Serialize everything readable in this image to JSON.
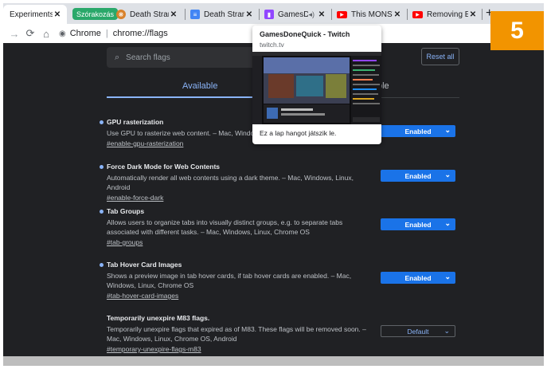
{
  "tabs": [
    {
      "title": "Experiments",
      "close": "✕",
      "favicon": "none",
      "active": true
    },
    {
      "title": "Death Stranding",
      "close": "✕",
      "favicon": "fan-icon"
    },
    {
      "title": "Death Stranding",
      "close": "✕",
      "favicon": "document-icon"
    },
    {
      "title": "GamesDone",
      "close": "✕",
      "favicon": "twitch-icon",
      "audio": "speaker-icon"
    },
    {
      "title": "This MONSTER",
      "close": "✕",
      "favicon": "youtube-icon"
    },
    {
      "title": "Removing EVER",
      "close": "✕",
      "favicon": "youtube-icon"
    }
  ],
  "tab_group": {
    "label": "Szórakozás",
    "color": "#2aa86a"
  },
  "new_tab": "+",
  "toolbar": {
    "site_label": "Chrome",
    "url": "chrome://flags"
  },
  "search": {
    "placeholder": "Search flags"
  },
  "reset_label": "Reset all",
  "flag_tabs": {
    "available": "Available",
    "unavailable": "ble"
  },
  "flags": [
    {
      "title": "GPU rasterization",
      "description": "Use GPU to rasterize web content. – Mac, Windows",
      "link": "#enable-gpu-rasterization",
      "value": "Enabled"
    },
    {
      "title": "Force Dark Mode for Web Contents",
      "description": "Automatically render all web contents using a dark theme. – Mac, Windows, Linux, Android",
      "link": "#enable-force-dark",
      "value": "Enabled"
    },
    {
      "title": "Tab Groups",
      "description": "Allows users to organize tabs into visually distinct groups, e.g. to separate tabs associated with different tasks. – Mac, Windows, Linux, Chrome OS",
      "link": "#tab-groups",
      "value": "Enabled"
    },
    {
      "title": "Tab Hover Card Images",
      "description": "Shows a preview image in tab hover cards, if tab hover cards are enabled. – Mac, Windows, Linux, Chrome OS",
      "link": "#tab-hover-card-images",
      "value": "Enabled"
    },
    {
      "title": "Temporarily unexpire M83 flags.",
      "description": "Temporarily unexpire flags that expired as of M83. These flags will be removed soon. – Mac, Windows, Linux, Chrome OS, Android",
      "link": "#temporary-unexpire-flags-m83",
      "value": "Default"
    }
  ],
  "hover_card": {
    "title": "GamesDoneQuick - Twitch",
    "domain": "twitch.tv",
    "audio_note": "Ez a lap hangot játszik le."
  },
  "badge": "5",
  "colors": {
    "accent": "#8ab4f8",
    "select_blue": "#1a73e8",
    "badge_orange": "#f29400"
  }
}
